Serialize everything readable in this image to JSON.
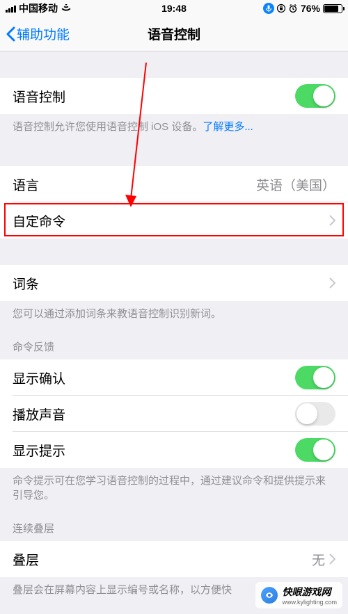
{
  "status": {
    "carrier": "中国移动",
    "time": "19:48",
    "battery_pct": "76%"
  },
  "nav": {
    "back": "辅助功能",
    "title": "语音控制"
  },
  "voice_control": {
    "label": "语音控制",
    "on": true,
    "footer": "语音控制允许您使用语音控制 iOS 设备。",
    "learn_more": "了解更多..."
  },
  "language": {
    "label": "语言",
    "value": "英语（美国）"
  },
  "custom_commands": {
    "label": "自定命令"
  },
  "vocab": {
    "label": "词条",
    "footer": "您可以通过添加词条来教语音控制识别新词。"
  },
  "feedback": {
    "header": "命令反馈",
    "confirm": {
      "label": "显示确认",
      "on": true
    },
    "sound": {
      "label": "播放声音",
      "on": false
    },
    "hints": {
      "label": "显示提示",
      "on": true
    },
    "footer": "命令提示可在您学习语音控制的过程中，通过建议命令和提供提示来引导您。"
  },
  "overlay": {
    "header": "连续叠层",
    "label": "叠层",
    "value": "无",
    "footer": "叠层会在屏幕内容上显示编号或名称，以方便快"
  },
  "watermark": {
    "text": "快眼游戏网",
    "url": "www.kylighting.com"
  }
}
